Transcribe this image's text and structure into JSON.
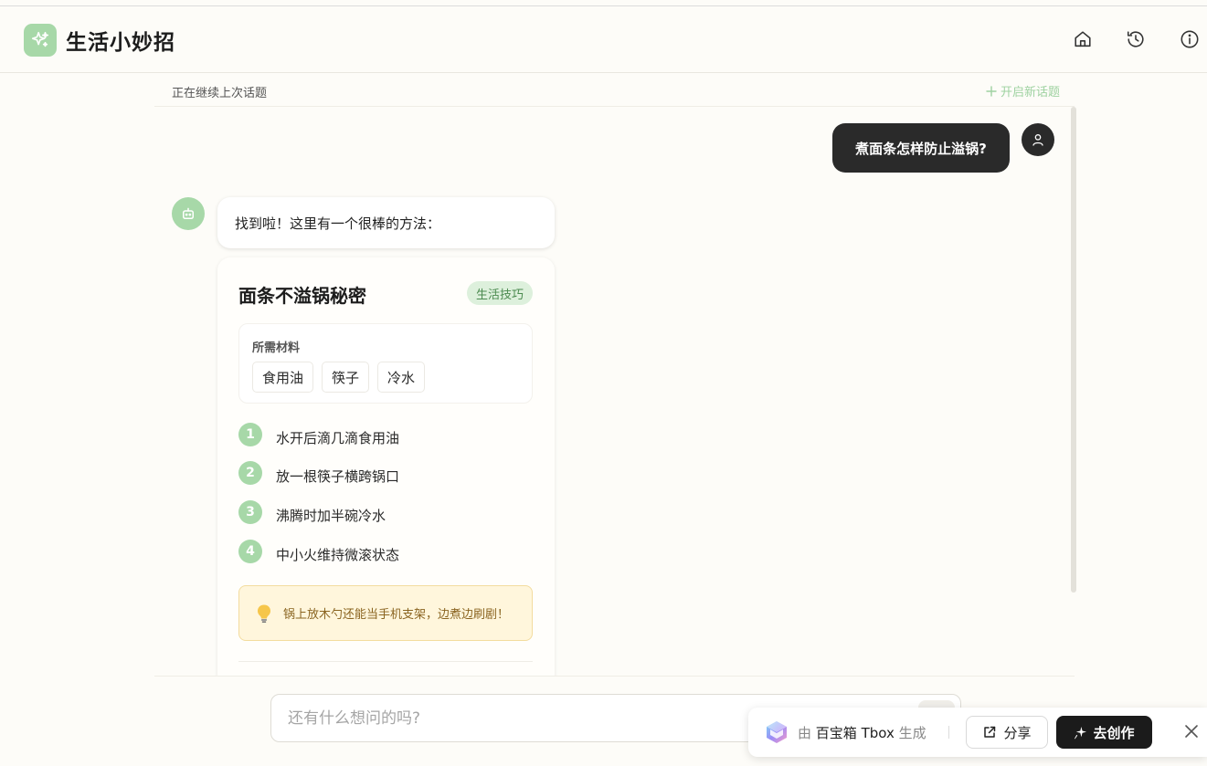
{
  "app": {
    "title": "生活小妙招",
    "accent": "#a7d8a8"
  },
  "header": {
    "icons": [
      "home-icon",
      "history-icon",
      "info-icon"
    ]
  },
  "subbar": {
    "status": "正在继续上次话题",
    "new_topic_label": "开启新话题"
  },
  "conversation": {
    "user_message": "煮面条怎样防止溢锅?",
    "bot_intro": "找到啦！这里有一个很棒的方法："
  },
  "card": {
    "title": "面条不溢锅秘密",
    "badge": "生活技巧",
    "materials_label": "所需材料",
    "materials": [
      "食用油",
      "筷子",
      "冷水"
    ],
    "steps": [
      {
        "num": "1",
        "text": "水开后滴几滴食用油"
      },
      {
        "num": "2",
        "text": "放一根筷子横跨锅口"
      },
      {
        "num": "3",
        "text": "沸腾时加半碗冷水"
      },
      {
        "num": "4",
        "text": "中小火维持微滚状态"
      }
    ],
    "tip": "锅上放木勺还能当手机支架，边煮边刷剧！"
  },
  "input": {
    "placeholder": "还有什么想问的吗?"
  },
  "tbox": {
    "prefix": "由",
    "brand": "百宝箱 Tbox",
    "suffix": "生成",
    "share_label": "分享",
    "create_label": "去创作"
  }
}
